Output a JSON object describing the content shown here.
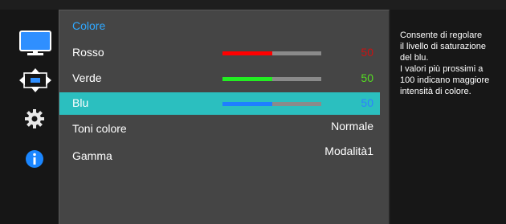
{
  "menu": {
    "title": "Colore",
    "items": [
      {
        "label": "Rosso",
        "type": "slider",
        "value": "50",
        "level": 0.5,
        "fill_color": "#ff0000",
        "value_color": "#cc1111"
      },
      {
        "label": "Verde",
        "type": "slider",
        "value": "50",
        "level": 0.5,
        "fill_color": "#22ee22",
        "value_color": "#55dd22"
      },
      {
        "label": "Blu",
        "type": "slider",
        "value": "50",
        "level": 0.5,
        "fill_color": "#1e7fff",
        "value_color": "#2f7fff",
        "selected": true
      },
      {
        "label": "Toni colore",
        "type": "option",
        "value": "Normale"
      },
      {
        "label": "Gamma",
        "type": "option",
        "value": "Modalità1"
      }
    ]
  },
  "sidebar": {
    "icons": [
      "monitor-icon",
      "resize-arrows-icon",
      "gear-icon",
      "info-icon"
    ]
  },
  "help": {
    "lines": [
      "Consente di regolare",
      "il livello di saturazione",
      "del blu.",
      "I valori più prossimi a",
      "100 indicano maggiore",
      "intensità di colore."
    ]
  },
  "colors": {
    "accent_title": "#2fa8ff",
    "selection": "#2bbfbf",
    "icon_blue": "#1a86ff"
  }
}
